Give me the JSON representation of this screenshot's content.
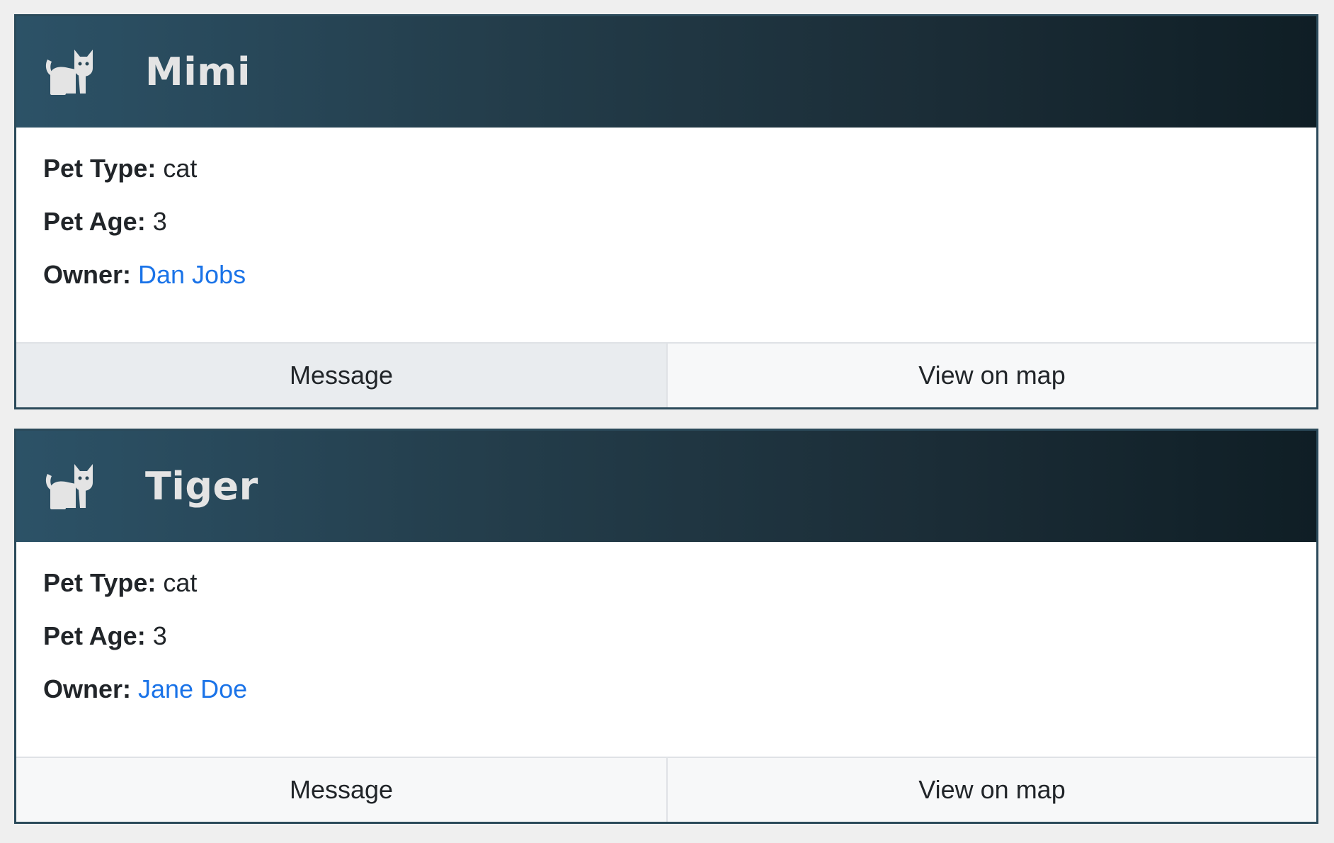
{
  "labels": {
    "pet_type": "Pet Type:",
    "pet_age": "Pet Age:",
    "owner": "Owner:"
  },
  "colors": {
    "header_gradient_start": "#2c5267",
    "header_gradient_end": "#0f1e25",
    "border": "#2b4a5a",
    "link": "#1a73e8",
    "button_bg": "#f7f8f9",
    "button_active_bg": "#e9ecef"
  },
  "cards": [
    {
      "icon": "cat-icon",
      "name": "Mimi",
      "pet_type": "cat",
      "pet_age": "3",
      "owner": "Dan Jobs",
      "buttons": {
        "message": "Message",
        "map": "View on map"
      }
    },
    {
      "icon": "cat-icon",
      "name": "Tiger",
      "pet_type": "cat",
      "pet_age": "3",
      "owner": "Jane Doe",
      "buttons": {
        "message": "Message",
        "map": "View on map"
      }
    }
  ]
}
